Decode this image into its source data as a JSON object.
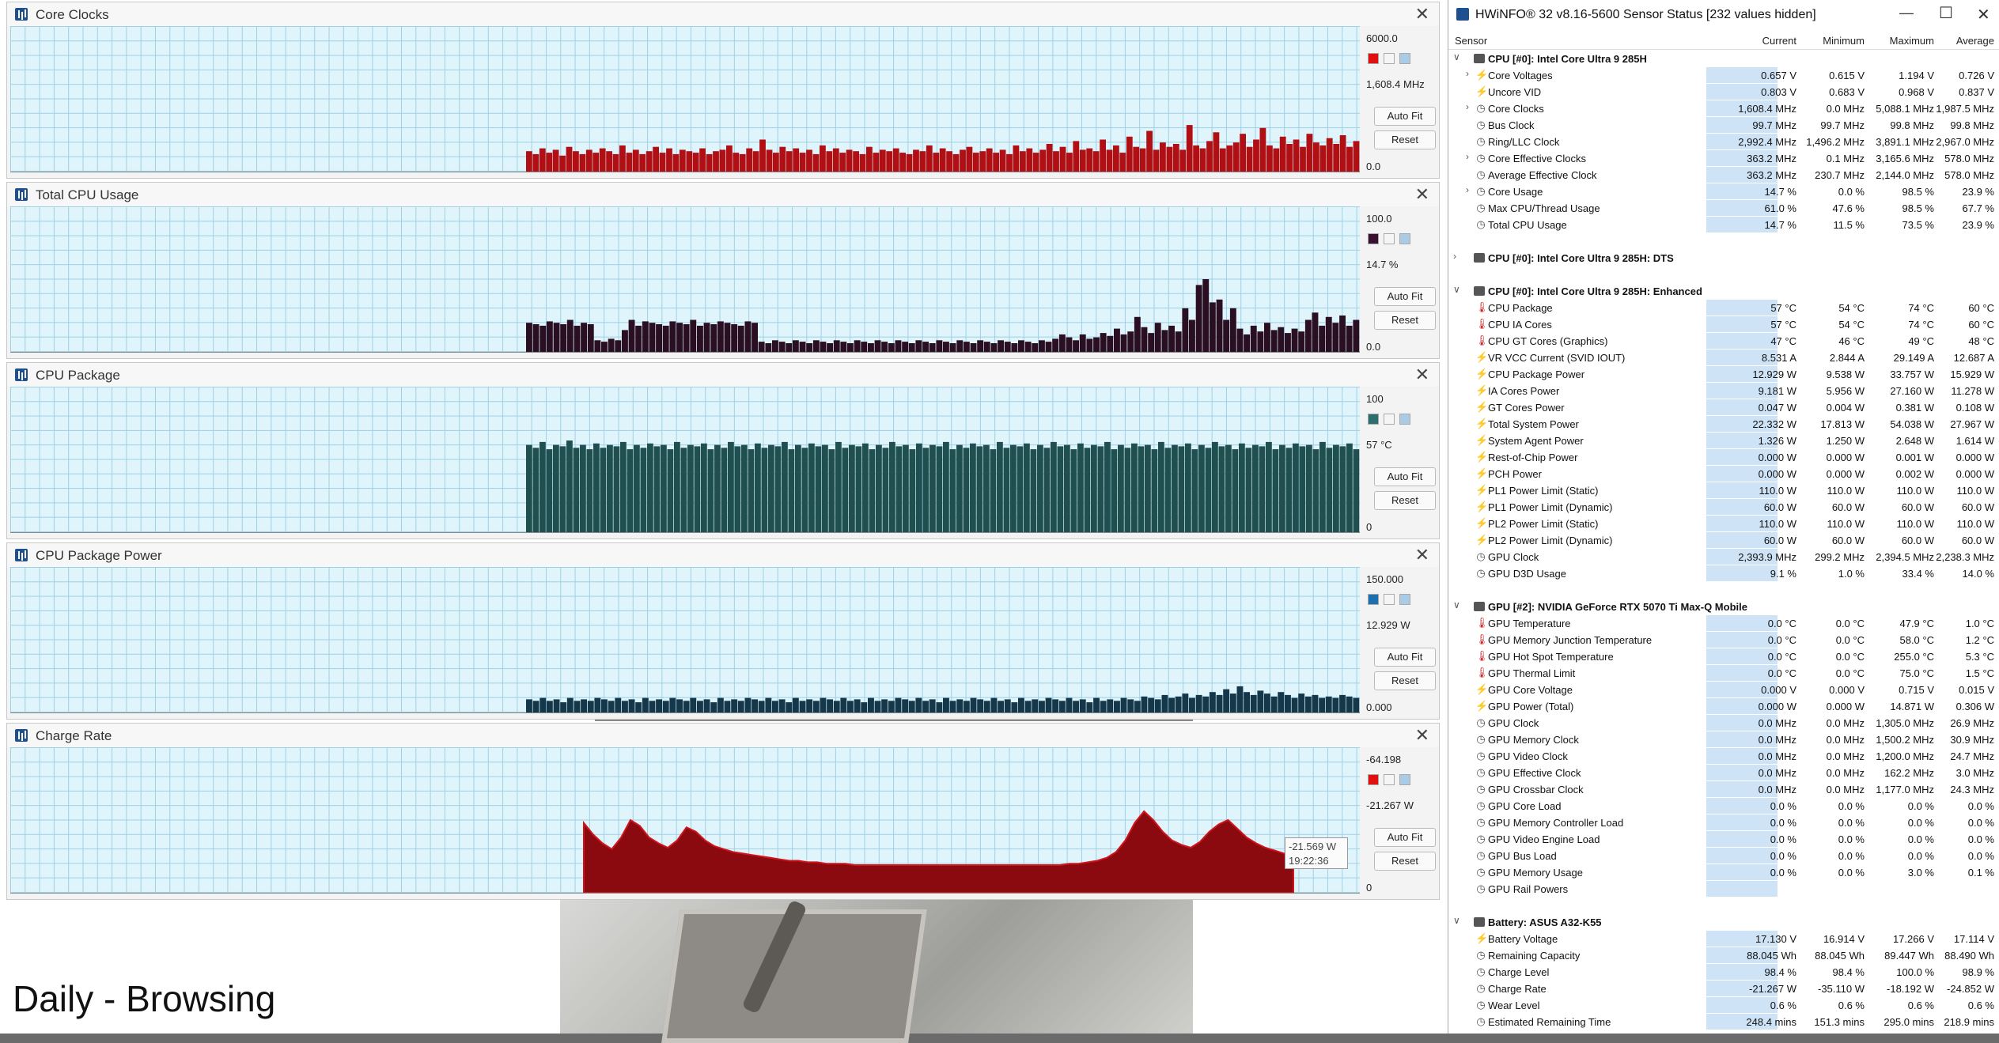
{
  "background": {
    "caption": "Daily - Browsing"
  },
  "graphs": [
    {
      "title": "Core Clocks",
      "max": "6000.0",
      "current": "1,608.4 MHz",
      "min": "0.0",
      "color": "#b00f14",
      "swatch": "#e01010",
      "autofit": "Auto Fit",
      "reset": "Reset",
      "data": [
        0.14,
        0.12,
        0.16,
        0.13,
        0.15,
        0.11,
        0.17,
        0.14,
        0.12,
        0.15,
        0.13,
        0.16,
        0.14,
        0.12,
        0.18,
        0.13,
        0.15,
        0.12,
        0.14,
        0.17,
        0.13,
        0.16,
        0.12,
        0.15,
        0.14,
        0.13,
        0.16,
        0.12,
        0.14,
        0.15,
        0.18,
        0.13,
        0.12,
        0.16,
        0.14,
        0.22,
        0.15,
        0.13,
        0.17,
        0.14,
        0.16,
        0.13,
        0.15,
        0.12,
        0.18,
        0.14,
        0.16,
        0.13,
        0.15,
        0.14,
        0.12,
        0.17,
        0.13,
        0.15,
        0.14,
        0.16,
        0.13,
        0.12,
        0.15,
        0.14,
        0.18,
        0.13,
        0.16,
        0.14,
        0.12,
        0.15,
        0.17,
        0.13,
        0.14,
        0.16,
        0.13,
        0.15,
        0.12,
        0.18,
        0.14,
        0.16,
        0.13,
        0.15,
        0.19,
        0.14,
        0.17,
        0.13,
        0.21,
        0.15,
        0.16,
        0.14,
        0.22,
        0.15,
        0.18,
        0.13,
        0.24,
        0.17,
        0.16,
        0.28,
        0.15,
        0.2,
        0.17,
        0.19,
        0.15,
        0.32,
        0.18,
        0.16,
        0.21,
        0.27,
        0.16,
        0.18,
        0.2,
        0.26,
        0.17,
        0.22,
        0.3,
        0.18,
        0.16,
        0.24,
        0.19,
        0.22,
        0.17,
        0.26,
        0.2,
        0.18,
        0.23,
        0.19,
        0.25,
        0.17,
        0.21
      ]
    },
    {
      "title": "Total CPU Usage",
      "max": "100.0",
      "current": "14.7 %",
      "min": "0.0",
      "color": "#2a0f22",
      "swatch": "#3a1030",
      "autofit": "Auto Fit",
      "reset": "Reset",
      "data": [
        0.2,
        0.19,
        0.18,
        0.21,
        0.2,
        0.19,
        0.22,
        0.18,
        0.2,
        0.19,
        0.08,
        0.07,
        0.09,
        0.08,
        0.15,
        0.22,
        0.18,
        0.21,
        0.2,
        0.19,
        0.18,
        0.21,
        0.2,
        0.19,
        0.22,
        0.18,
        0.2,
        0.19,
        0.21,
        0.2,
        0.19,
        0.18,
        0.21,
        0.2,
        0.07,
        0.06,
        0.08,
        0.07,
        0.06,
        0.08,
        0.07,
        0.06,
        0.08,
        0.07,
        0.06,
        0.08,
        0.07,
        0.06,
        0.08,
        0.07,
        0.06,
        0.08,
        0.07,
        0.06,
        0.08,
        0.07,
        0.06,
        0.08,
        0.07,
        0.06,
        0.08,
        0.07,
        0.06,
        0.08,
        0.07,
        0.06,
        0.08,
        0.07,
        0.06,
        0.08,
        0.07,
        0.06,
        0.08,
        0.07,
        0.06,
        0.08,
        0.07,
        0.09,
        0.12,
        0.1,
        0.08,
        0.12,
        0.09,
        0.1,
        0.13,
        0.11,
        0.16,
        0.12,
        0.14,
        0.24,
        0.17,
        0.13,
        0.2,
        0.15,
        0.18,
        0.14,
        0.3,
        0.22,
        0.46,
        0.5,
        0.34,
        0.36,
        0.22,
        0.3,
        0.16,
        0.12,
        0.18,
        0.14,
        0.2,
        0.15,
        0.17,
        0.13,
        0.16,
        0.14,
        0.22,
        0.27,
        0.18,
        0.24,
        0.2,
        0.25,
        0.18,
        0.22
      ]
    },
    {
      "title": "CPU Package",
      "max": "100",
      "current": "57 °C",
      "min": "0",
      "color": "#1f4f4f",
      "swatch": "#2e6d6d",
      "autofit": "Auto Fit",
      "reset": "Reset",
      "data": [
        0.6,
        0.58,
        0.62,
        0.57,
        0.6,
        0.59,
        0.63,
        0.58,
        0.6,
        0.57,
        0.61,
        0.58,
        0.6,
        0.59,
        0.62,
        0.57,
        0.6,
        0.58,
        0.61,
        0.59,
        0.6,
        0.57,
        0.62,
        0.58,
        0.6,
        0.59,
        0.61,
        0.57,
        0.6,
        0.58,
        0.62,
        0.59,
        0.6,
        0.57,
        0.61,
        0.58,
        0.6,
        0.59,
        0.62,
        0.57,
        0.6,
        0.58,
        0.61,
        0.59,
        0.6,
        0.57,
        0.62,
        0.58,
        0.6,
        0.59,
        0.61,
        0.57,
        0.6,
        0.58,
        0.62,
        0.59,
        0.6,
        0.57,
        0.61,
        0.58,
        0.6,
        0.59,
        0.62,
        0.57,
        0.6,
        0.58,
        0.61,
        0.59,
        0.6,
        0.57,
        0.62,
        0.58,
        0.6,
        0.59,
        0.61,
        0.57,
        0.6,
        0.58,
        0.62,
        0.59,
        0.6,
        0.57,
        0.61,
        0.58,
        0.6,
        0.59,
        0.62,
        0.57,
        0.6,
        0.58,
        0.61,
        0.59,
        0.6,
        0.57,
        0.62,
        0.58,
        0.6,
        0.59,
        0.61,
        0.57,
        0.6,
        0.58,
        0.62,
        0.59,
        0.6,
        0.57,
        0.61,
        0.58,
        0.6,
        0.59,
        0.62,
        0.57,
        0.6,
        0.58,
        0.61,
        0.59,
        0.6,
        0.57,
        0.62,
        0.58,
        0.6,
        0.59,
        0.61,
        0.57
      ]
    },
    {
      "title": "CPU Package Power",
      "max": "150.000",
      "current": "12.929 W",
      "min": "0.000",
      "color": "#14384a",
      "swatch": "#1e6fae",
      "autofit": "Auto Fit",
      "reset": "Reset",
      "data": [
        0.09,
        0.08,
        0.1,
        0.08,
        0.09,
        0.07,
        0.1,
        0.08,
        0.09,
        0.08,
        0.1,
        0.09,
        0.08,
        0.1,
        0.08,
        0.09,
        0.07,
        0.1,
        0.08,
        0.09,
        0.08,
        0.1,
        0.09,
        0.08,
        0.1,
        0.08,
        0.09,
        0.07,
        0.1,
        0.08,
        0.09,
        0.08,
        0.1,
        0.09,
        0.08,
        0.1,
        0.08,
        0.09,
        0.07,
        0.1,
        0.08,
        0.09,
        0.08,
        0.1,
        0.09,
        0.08,
        0.1,
        0.08,
        0.09,
        0.07,
        0.1,
        0.08,
        0.09,
        0.08,
        0.1,
        0.09,
        0.08,
        0.1,
        0.08,
        0.09,
        0.07,
        0.1,
        0.08,
        0.09,
        0.08,
        0.1,
        0.09,
        0.08,
        0.1,
        0.08,
        0.09,
        0.07,
        0.1,
        0.08,
        0.09,
        0.08,
        0.1,
        0.09,
        0.08,
        0.1,
        0.08,
        0.09,
        0.07,
        0.1,
        0.08,
        0.09,
        0.08,
        0.1,
        0.09,
        0.08,
        0.11,
        0.1,
        0.09,
        0.12,
        0.1,
        0.11,
        0.13,
        0.1,
        0.12,
        0.11,
        0.14,
        0.12,
        0.16,
        0.13,
        0.18,
        0.14,
        0.12,
        0.15,
        0.13,
        0.11,
        0.14,
        0.12,
        0.1,
        0.13,
        0.11,
        0.12,
        0.1,
        0.11,
        0.1,
        0.12,
        0.11,
        0.1
      ]
    },
    {
      "title": "Charge Rate",
      "max": "-64.198",
      "current": "-21.267 W",
      "min": "0",
      "color": "#8b0a10",
      "swatch": "#e01010",
      "autofit": "Auto Fit",
      "reset": "Reset",
      "data": [
        0.48,
        0.4,
        0.34,
        0.3,
        0.38,
        0.5,
        0.46,
        0.38,
        0.34,
        0.31,
        0.36,
        0.45,
        0.42,
        0.36,
        0.32,
        0.3,
        0.28,
        0.27,
        0.26,
        0.25,
        0.24,
        0.23,
        0.22,
        0.22,
        0.21,
        0.21,
        0.2,
        0.2,
        0.2,
        0.19,
        0.19,
        0.19,
        0.19,
        0.19,
        0.19,
        0.19,
        0.19,
        0.19,
        0.19,
        0.19,
        0.19,
        0.19,
        0.19,
        0.19,
        0.19,
        0.19,
        0.19,
        0.19,
        0.19,
        0.19,
        0.19,
        0.19,
        0.2,
        0.2,
        0.21,
        0.22,
        0.24,
        0.28,
        0.36,
        0.48,
        0.56,
        0.5,
        0.42,
        0.36,
        0.33,
        0.31,
        0.35,
        0.42,
        0.47,
        0.5,
        0.44,
        0.38,
        0.34,
        0.31,
        0.29,
        0.27,
        0.25
      ]
    }
  ],
  "tooltip": {
    "value": "-21.569 W",
    "time": "19:22:36"
  },
  "hwinfo": {
    "title": "HWiNFO® 32 v8.16-5600 Sensor Status [232 values hidden]",
    "columns": {
      "sensor": "Sensor",
      "current": "Current",
      "minimum": "Minimum",
      "maximum": "Maximum",
      "average": "Average"
    },
    "rows": [
      {
        "type": "group",
        "label": "CPU [#0]: Intel Core Ultra 9 285H",
        "open": true
      },
      {
        "label": "Core Voltages",
        "icon": "bolt",
        "exp": true,
        "cur": "0.657 V",
        "min": "0.615 V",
        "max": "1.194 V",
        "avg": "0.726 V"
      },
      {
        "label": "Uncore VID",
        "icon": "bolt",
        "cur": "0.803 V",
        "min": "0.683 V",
        "max": "0.968 V",
        "avg": "0.837 V"
      },
      {
        "label": "Core Clocks",
        "icon": "clock",
        "exp": true,
        "cur": "1,608.4 MHz",
        "min": "0.0 MHz",
        "max": "5,088.1 MHz",
        "avg": "1,987.5 MHz"
      },
      {
        "label": "Bus Clock",
        "icon": "clock",
        "cur": "99.7 MHz",
        "min": "99.7 MHz",
        "max": "99.8 MHz",
        "avg": "99.8 MHz"
      },
      {
        "label": "Ring/LLC Clock",
        "icon": "clock",
        "cur": "2,992.4 MHz",
        "min": "1,496.2 MHz",
        "max": "3,891.1 MHz",
        "avg": "2,967.0 MHz"
      },
      {
        "label": "Core Effective Clocks",
        "icon": "clock",
        "exp": true,
        "cur": "363.2 MHz",
        "min": "0.1 MHz",
        "max": "3,165.6 MHz",
        "avg": "578.0 MHz"
      },
      {
        "label": "Average Effective Clock",
        "icon": "clock",
        "cur": "363.2 MHz",
        "min": "230.7 MHz",
        "max": "2,144.0 MHz",
        "avg": "578.0 MHz"
      },
      {
        "label": "Core Usage",
        "icon": "clock",
        "exp": true,
        "cur": "14.7 %",
        "min": "0.0 %",
        "max": "98.5 %",
        "avg": "23.9 %"
      },
      {
        "label": "Max CPU/Thread Usage",
        "icon": "clock",
        "cur": "61.0 %",
        "min": "47.6 %",
        "max": "98.5 %",
        "avg": "67.7 %"
      },
      {
        "label": "Total CPU Usage",
        "icon": "clock",
        "cur": "14.7 %",
        "min": "11.5 %",
        "max": "73.5 %",
        "avg": "23.9 %"
      },
      {
        "type": "spacer"
      },
      {
        "type": "group",
        "label": "CPU [#0]: Intel Core Ultra 9 285H: DTS",
        "open": false
      },
      {
        "type": "spacer"
      },
      {
        "type": "group",
        "label": "CPU [#0]: Intel Core Ultra 9 285H: Enhanced",
        "open": true
      },
      {
        "label": "CPU Package",
        "icon": "therm",
        "cur": "57 °C",
        "min": "54 °C",
        "max": "74 °C",
        "avg": "60 °C"
      },
      {
        "label": "CPU IA Cores",
        "icon": "therm",
        "cur": "57 °C",
        "min": "54 °C",
        "max": "74 °C",
        "avg": "60 °C"
      },
      {
        "label": "CPU GT Cores (Graphics)",
        "icon": "therm",
        "cur": "47 °C",
        "min": "46 °C",
        "max": "49 °C",
        "avg": "48 °C"
      },
      {
        "label": "VR VCC Current (SVID IOUT)",
        "icon": "bolt",
        "cur": "8.531 A",
        "min": "2.844 A",
        "max": "29.149 A",
        "avg": "12.687 A"
      },
      {
        "label": "CPU Package Power",
        "icon": "bolt",
        "cur": "12.929 W",
        "min": "9.538 W",
        "max": "33.757 W",
        "avg": "15.929 W"
      },
      {
        "label": "IA Cores Power",
        "icon": "bolt",
        "cur": "9.181 W",
        "min": "5.956 W",
        "max": "27.160 W",
        "avg": "11.278 W"
      },
      {
        "label": "GT Cores Power",
        "icon": "bolt",
        "cur": "0.047 W",
        "min": "0.004 W",
        "max": "0.381 W",
        "avg": "0.108 W"
      },
      {
        "label": "Total System Power",
        "icon": "bolt",
        "cur": "22.332 W",
        "min": "17.813 W",
        "max": "54.038 W",
        "avg": "27.967 W"
      },
      {
        "label": "System Agent Power",
        "icon": "bolt",
        "cur": "1.326 W",
        "min": "1.250 W",
        "max": "2.648 W",
        "avg": "1.614 W"
      },
      {
        "label": "Rest-of-Chip Power",
        "icon": "bolt",
        "cur": "0.000 W",
        "min": "0.000 W",
        "max": "0.001 W",
        "avg": "0.000 W"
      },
      {
        "label": "PCH Power",
        "icon": "bolt",
        "cur": "0.000 W",
        "min": "0.000 W",
        "max": "0.002 W",
        "avg": "0.000 W"
      },
      {
        "label": "PL1 Power Limit (Static)",
        "icon": "bolt",
        "cur": "110.0 W",
        "min": "110.0 W",
        "max": "110.0 W",
        "avg": "110.0 W"
      },
      {
        "label": "PL1 Power Limit (Dynamic)",
        "icon": "bolt",
        "cur": "60.0 W",
        "min": "60.0 W",
        "max": "60.0 W",
        "avg": "60.0 W"
      },
      {
        "label": "PL2 Power Limit (Static)",
        "icon": "bolt",
        "cur": "110.0 W",
        "min": "110.0 W",
        "max": "110.0 W",
        "avg": "110.0 W"
      },
      {
        "label": "PL2 Power Limit (Dynamic)",
        "icon": "bolt",
        "cur": "60.0 W",
        "min": "60.0 W",
        "max": "60.0 W",
        "avg": "60.0 W"
      },
      {
        "label": "GPU Clock",
        "icon": "clock",
        "cur": "2,393.9 MHz",
        "min": "299.2 MHz",
        "max": "2,394.5 MHz",
        "avg": "2,238.3 MHz"
      },
      {
        "label": "GPU D3D Usage",
        "icon": "clock",
        "cur": "9.1 %",
        "min": "1.0 %",
        "max": "33.4 %",
        "avg": "14.0 %"
      },
      {
        "type": "spacer"
      },
      {
        "type": "group",
        "label": "GPU [#2]: NVIDIA  GeForce RTX 5070 Ti Max-Q Mobile",
        "open": true
      },
      {
        "label": "GPU Temperature",
        "icon": "therm",
        "cur": "0.0 °C",
        "min": "0.0 °C",
        "max": "47.9 °C",
        "avg": "1.0 °C"
      },
      {
        "label": "GPU Memory Junction Temperature",
        "icon": "therm",
        "cur": "0.0 °C",
        "min": "0.0 °C",
        "max": "58.0 °C",
        "avg": "1.2 °C"
      },
      {
        "label": "GPU Hot Spot Temperature",
        "icon": "therm",
        "cur": "0.0 °C",
        "min": "0.0 °C",
        "max": "255.0 °C",
        "avg": "5.3 °C"
      },
      {
        "label": "GPU Thermal Limit",
        "icon": "therm",
        "cur": "0.0 °C",
        "min": "0.0 °C",
        "max": "75.0 °C",
        "avg": "1.5 °C"
      },
      {
        "label": "GPU Core Voltage",
        "icon": "bolt",
        "cur": "0.000 V",
        "min": "0.000 V",
        "max": "0.715 V",
        "avg": "0.015 V"
      },
      {
        "label": "GPU Power (Total)",
        "icon": "bolt",
        "cur": "0.000 W",
        "min": "0.000 W",
        "max": "14.871 W",
        "avg": "0.306 W"
      },
      {
        "label": "GPU Clock",
        "icon": "clock",
        "cur": "0.0 MHz",
        "min": "0.0 MHz",
        "max": "1,305.0 MHz",
        "avg": "26.9 MHz"
      },
      {
        "label": "GPU Memory Clock",
        "icon": "clock",
        "cur": "0.0 MHz",
        "min": "0.0 MHz",
        "max": "1,500.2 MHz",
        "avg": "30.9 MHz"
      },
      {
        "label": "GPU Video Clock",
        "icon": "clock",
        "cur": "0.0 MHz",
        "min": "0.0 MHz",
        "max": "1,200.0 MHz",
        "avg": "24.7 MHz"
      },
      {
        "label": "GPU Effective Clock",
        "icon": "clock",
        "cur": "0.0 MHz",
        "min": "0.0 MHz",
        "max": "162.2 MHz",
        "avg": "3.0 MHz"
      },
      {
        "label": "GPU Crossbar Clock",
        "icon": "clock",
        "cur": "0.0 MHz",
        "min": "0.0 MHz",
        "max": "1,177.0 MHz",
        "avg": "24.3 MHz"
      },
      {
        "label": "GPU Core Load",
        "icon": "clock",
        "cur": "0.0 %",
        "min": "0.0 %",
        "max": "0.0 %",
        "avg": "0.0 %"
      },
      {
        "label": "GPU Memory Controller Load",
        "icon": "clock",
        "cur": "0.0 %",
        "min": "0.0 %",
        "max": "0.0 %",
        "avg": "0.0 %"
      },
      {
        "label": "GPU Video Engine Load",
        "icon": "clock",
        "cur": "0.0 %",
        "min": "0.0 %",
        "max": "0.0 %",
        "avg": "0.0 %"
      },
      {
        "label": "GPU Bus Load",
        "icon": "clock",
        "cur": "0.0 %",
        "min": "0.0 %",
        "max": "0.0 %",
        "avg": "0.0 %"
      },
      {
        "label": "GPU Memory Usage",
        "icon": "clock",
        "cur": "0.0 %",
        "min": "0.0 %",
        "max": "3.0 %",
        "avg": "0.1 %"
      },
      {
        "label": "GPU Rail Powers",
        "icon": "clock",
        "cur": "",
        "min": "",
        "max": "",
        "avg": ""
      },
      {
        "type": "spacer"
      },
      {
        "type": "group",
        "label": "Battery: ASUS  A32-K55",
        "open": true
      },
      {
        "label": "Battery Voltage",
        "icon": "bolt",
        "cur": "17.130 V",
        "min": "16.914 V",
        "max": "17.266 V",
        "avg": "17.114 V"
      },
      {
        "label": "Remaining Capacity",
        "icon": "clock",
        "cur": "88.045 Wh",
        "min": "88.045 Wh",
        "max": "89.447 Wh",
        "avg": "88.490 Wh"
      },
      {
        "label": "Charge Level",
        "icon": "clock",
        "cur": "98.4 %",
        "min": "98.4 %",
        "max": "100.0 %",
        "avg": "98.9 %"
      },
      {
        "label": "Charge Rate",
        "icon": "clock",
        "cur": "-21.267 W",
        "min": "-35.110 W",
        "max": "-18.192 W",
        "avg": "-24.852 W"
      },
      {
        "label": "Wear Level",
        "icon": "clock",
        "cur": "0.6 %",
        "min": "0.6 %",
        "max": "0.6 %",
        "avg": "0.6 %"
      },
      {
        "label": "Estimated Remaining Time",
        "icon": "clock",
        "cur": "248.4 mins",
        "min": "151.3 mins",
        "max": "295.0 mins",
        "avg": "218.9 mins"
      }
    ]
  }
}
